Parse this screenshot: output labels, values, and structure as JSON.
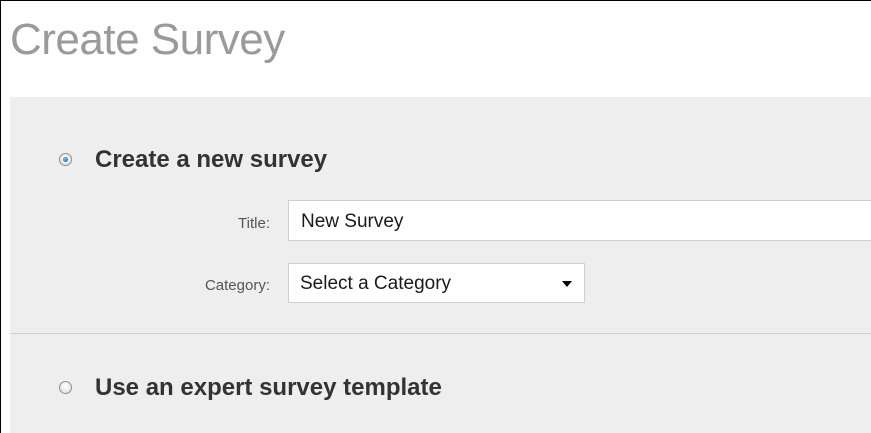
{
  "page": {
    "title": "Create Survey"
  },
  "options": {
    "new_survey": {
      "label": "Create a new survey",
      "selected": true
    },
    "template": {
      "label": "Use an expert survey template",
      "selected": false
    }
  },
  "form": {
    "title_label": "Title:",
    "title_value": "New Survey",
    "category_label": "Category:",
    "category_value": "Select a Category"
  },
  "icons": {
    "select_arrow": "chevron-down-icon"
  }
}
